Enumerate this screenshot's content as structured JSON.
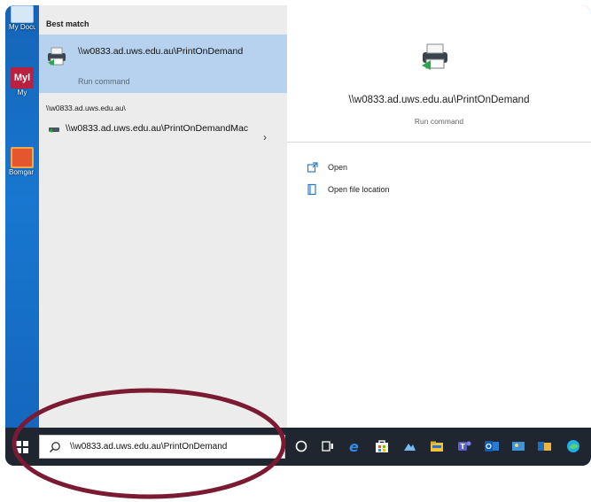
{
  "desktop": {
    "icons": [
      {
        "label": "My Docum"
      },
      {
        "label": "My",
        "badge": "Myl"
      },
      {
        "label": "Bomgar Shortc"
      }
    ]
  },
  "results": {
    "best_match_header": "Best match",
    "best_match": {
      "title": "\\\\w0833.ad.uws.edu.au\\PrintOnDemand",
      "subtitle": "Run command",
      "icon": "printer-icon"
    },
    "group_header": "\\\\w0833.ad.uws.edu.au\\",
    "items": [
      {
        "title": "\\\\w0833.ad.uws.edu.au\\PrintOnDemandMac",
        "icon": "printer-small-icon",
        "chevron": "›"
      }
    ]
  },
  "detail": {
    "title": "\\\\w0833.ad.uws.edu.au\\PrintOnDemand",
    "subtitle": "Run command",
    "actions": [
      {
        "label": "Open",
        "icon": "open-icon"
      },
      {
        "label": "Open file location",
        "icon": "file-location-icon"
      }
    ]
  },
  "taskbar": {
    "search_value": "\\\\w0833.ad.uws.edu.au\\PrintOnDemand",
    "icons": [
      "cortana-icon",
      "task-view-icon",
      "edge-legacy-icon",
      "store-icon",
      "photos-icon",
      "file-explorer-icon",
      "teams-icon",
      "outlook-icon",
      "edge-icon"
    ]
  },
  "colors": {
    "selection": "#b6d2ee",
    "annotation": "#7b1a33",
    "taskbar": "#1f2630",
    "desktop": "#1877d0"
  }
}
